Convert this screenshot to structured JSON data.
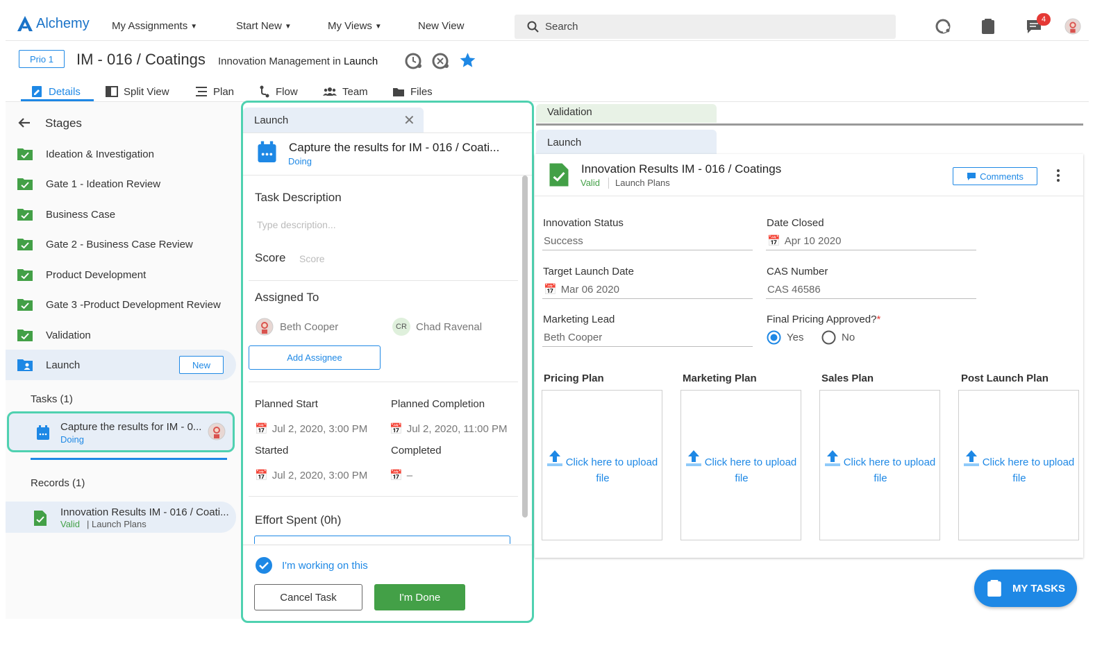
{
  "topnav": {
    "logo": "Alchemy",
    "items": [
      {
        "label": "My Assignments",
        "caret": true
      },
      {
        "label": "Start New",
        "caret": true
      },
      {
        "label": "My Views",
        "caret": true
      },
      {
        "label": "New View",
        "caret": false
      }
    ],
    "search_placeholder": "Search",
    "notification_count": "4"
  },
  "header": {
    "prio": "Prio 1",
    "title": "IM - 016 / Coatings",
    "subtitle_prefix": "Innovation Management in",
    "subtitle_stage": "Launch"
  },
  "tabs": [
    "Details",
    "Split View",
    "Plan",
    "Flow",
    "Team",
    "Files"
  ],
  "stages": {
    "title": "Stages",
    "items": [
      "Ideation & Investigation",
      "Gate 1 - Ideation Review",
      "Business Case",
      "Gate 2 - Business Case Review",
      "Product Development",
      "Gate 3 -Product Development Review",
      "Validation",
      "Launch"
    ],
    "new_label": "New",
    "tasks_label": "Tasks (1)",
    "task": {
      "title": "Capture the results for IM - 0...",
      "status": "Doing"
    },
    "records_label": "Records (1)",
    "record": {
      "title": "Innovation Results IM - 016 / Coati...",
      "status": "Valid",
      "type": "| Launch Plans"
    }
  },
  "task_panel": {
    "tab_label": "Launch",
    "title": "Capture the results for IM - 016 / Coati...",
    "status": "Doing",
    "desc_label": "Task Description",
    "desc_placeholder": "Type description...",
    "score_label": "Score",
    "score_placeholder": "Score",
    "assigned_label": "Assigned To",
    "assignees": [
      {
        "name": "Beth Cooper",
        "initials": ""
      },
      {
        "name": "Chad Ravenal",
        "initials": "CR"
      }
    ],
    "add_assignee": "Add Assignee",
    "planned_start_label": "Planned Start",
    "planned_start": "Jul 2, 2020, 3:00 PM",
    "planned_completion_label": "Planned Completion",
    "planned_completion": "Jul 2, 2020, 11:00 PM",
    "started_label": "Started",
    "started": "Jul 2, 2020, 3:00 PM",
    "completed_label": "Completed",
    "completed": "–",
    "effort_label": "Effort Spent (0h)",
    "working_label": "I'm working on this",
    "cancel": "Cancel Task",
    "done": "I'm Done"
  },
  "record_panel": {
    "tab_validation": "Validation",
    "tab_launch": "Launch",
    "title": "Innovation Results IM - 016 / Coatings",
    "status": "Valid",
    "type": "Launch Plans",
    "comments": "Comments",
    "fields": {
      "innovation_status_label": "Innovation Status",
      "innovation_status": "Success",
      "date_closed_label": "Date Closed",
      "date_closed": "Apr 10 2020",
      "target_launch_label": "Target Launch Date",
      "target_launch": "Mar 06 2020",
      "cas_label": "CAS Number",
      "cas": "CAS 46586",
      "marketing_lead_label": "Marketing Lead",
      "marketing_lead": "Beth Cooper",
      "final_pricing_label": "Final Pricing Approved?",
      "required_mark": "*",
      "yes": "Yes",
      "no": "No",
      "selected": "Yes"
    },
    "plans": [
      "Pricing Plan",
      "Marketing Plan",
      "Sales Plan",
      "Post Launch Plan"
    ],
    "upload_line1": "Click here to upload",
    "upload_line2": "file"
  },
  "my_tasks": "MY TASKS",
  "colors": {
    "accent": "#1e88e5",
    "success": "#43a047",
    "highlight": "#4fd1b0",
    "badge": "#e53935"
  }
}
